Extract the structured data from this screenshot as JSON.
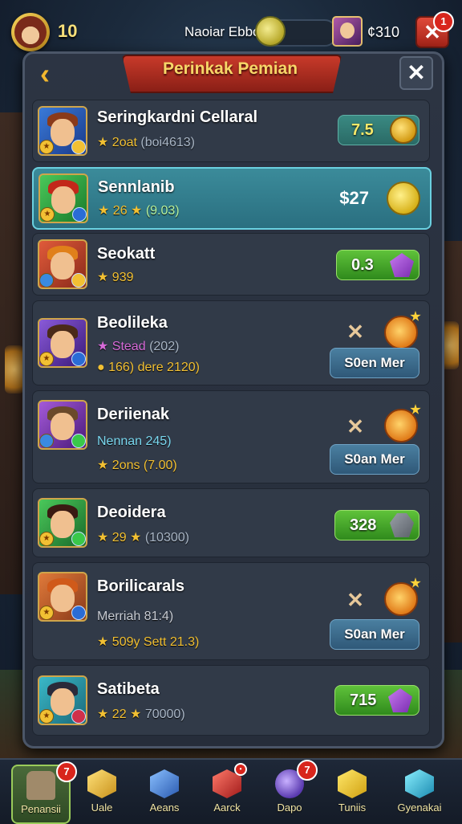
{
  "header": {
    "level": "10",
    "player_tag": "Naoiar Ebbo",
    "currency": "¢310",
    "notification_count": "1"
  },
  "panel": {
    "title": "Perinkak Pemian"
  },
  "rows": [
    {
      "name": "Seringkardni Cellaral",
      "line1_a": "★ 2oat",
      "line1_b": "(boi4613)",
      "action": "7.5",
      "action_type": "coin"
    },
    {
      "name": "Sennlanib",
      "line1_a": "★ 26 ★",
      "line1_b": "(9.03)",
      "action": "$27",
      "action_type": "coin-plain"
    },
    {
      "name": "Seokatt",
      "line1_a": "★ 939",
      "line1_b": "",
      "action": "0.3",
      "action_type": "gem"
    },
    {
      "name": "Beolileka",
      "line1_a": "★ Stead",
      "line1_b": "(202)",
      "line2": "● 166) dere 2120)",
      "action": "S0en Mer",
      "action_type": "claim"
    },
    {
      "name": "Deriienak",
      "line1_a": "Nennan 245)",
      "line1_b": "",
      "line2": "★ 2ons (7.00)",
      "action": "S0an Mer",
      "action_type": "claim"
    },
    {
      "name": "Deoidera",
      "line1_a": "★ 29 ★",
      "line1_b": "(10300)",
      "action": "328",
      "action_type": "stone"
    },
    {
      "name": "Borilicarals",
      "line1_a": "Merriah 81:4)",
      "line1_b": "",
      "line2": "★ 509y Sett 21.3)",
      "action": "S0an Mer",
      "action_type": "claim"
    },
    {
      "name": "Satibeta",
      "line1_a": "★ 22 ★",
      "line1_b": "70000)",
      "action": "715",
      "action_type": "gem"
    }
  ],
  "nav": [
    {
      "label": "Penansii",
      "badge": "7",
      "icon": "backpack-icon",
      "color": "#a08a6a"
    },
    {
      "label": "Uale",
      "badge": "",
      "icon": "gold-cube-icon",
      "color": "#f2c033"
    },
    {
      "label": "Aeans",
      "badge": "",
      "icon": "blue-cube-icon",
      "color": "#4a8ae0"
    },
    {
      "label": "Aarck",
      "badge": "•",
      "icon": "red-gem-icon",
      "color": "#e0403a"
    },
    {
      "label": "Dapo",
      "badge": "7",
      "icon": "orb-icon",
      "color": "#8a6ad8"
    },
    {
      "label": "Tuniis",
      "badge": "",
      "icon": "yellow-cube-icon",
      "color": "#f5c830"
    },
    {
      "label": "Gyenakai",
      "badge": "",
      "icon": "cyan-cube-icon",
      "color": "#3ab8d8"
    }
  ]
}
